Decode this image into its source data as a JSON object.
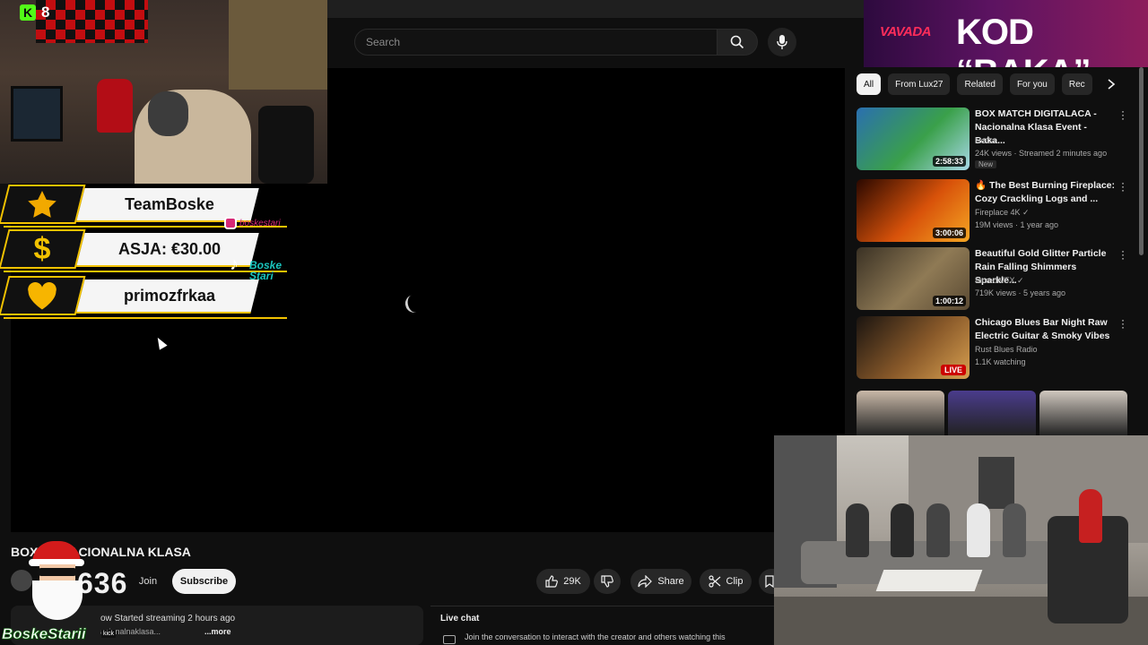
{
  "search": {
    "placeholder": "Search"
  },
  "video": {
    "title": "BOX MATCH DIGITALACA - NACIONALNA KLASA",
    "title_visible": "BOX        T - NACIONALNA KLASA",
    "subscriber_fragment": "636",
    "join_label": "Join",
    "subscribe_label": "Subscribe",
    "like_count": "29K",
    "share_label": "Share",
    "clip_label": "Clip",
    "description_line1": "ow  Started streaming 2 hours ago",
    "description_line2": "acionalnaklasa...",
    "description_more": "...more"
  },
  "live_chat": {
    "title": "Live chat",
    "message": "Join the conversation to interact with the creator and others watching this"
  },
  "sidebar": {
    "chips": [
      {
        "label": "All",
        "active": true
      },
      {
        "label": "From Lux27",
        "active": false
      },
      {
        "label": "Related",
        "active": false
      },
      {
        "label": "For you",
        "active": false
      },
      {
        "label": "Rec",
        "active": false
      }
    ],
    "recommendations": [
      {
        "title": "BOX MATCH DIGITALACA - Nacionalna Klasa Event - Baka...",
        "channel": "NeCa",
        "meta": "24K views · Streamed 2 minutes ago",
        "badge": "New",
        "duration": "2:58:33",
        "thumb_colors": [
          "#2a6fb0",
          "#3aa04a",
          "#a8d8e8"
        ]
      },
      {
        "title": "🔥 The Best Burning Fireplace: Cozy Crackling Logs and ...",
        "channel": "Fireplace 4K ✓",
        "meta": "19M views · 1 year ago",
        "badge": "",
        "duration": "3:00:06",
        "thumb_colors": [
          "#2a0800",
          "#d8520a",
          "#f5a623"
        ]
      },
      {
        "title": "Beautiful Gold Glitter Particle Rain Falling Shimmers Sparkle...",
        "channel": "IncrediVFX ✓",
        "meta": "719K views · 5 years ago",
        "badge": "",
        "duration": "1:00:12",
        "thumb_colors": [
          "#3a3124",
          "#8f7a55",
          "#5a4a33"
        ]
      },
      {
        "title": "Chicago Blues Bar Night Raw Electric Guitar & Smoky Vibes",
        "channel": "Rust Blues Radio",
        "meta": "1.1K watching",
        "badge": "",
        "live_label": "LIVE",
        "thumb_colors": [
          "#1a1410",
          "#8a5a2a",
          "#d8a050"
        ]
      }
    ],
    "short_colors": [
      "#c9b8a8",
      "#4a3c8c",
      "#d0c8bf"
    ]
  },
  "ad": {
    "brand": "VAVADA",
    "code_text": "KOD “BAKA”"
  },
  "stream_overlay": {
    "kick_viewers": "8",
    "donations": [
      {
        "icon": "star",
        "text": "TeamBoske"
      },
      {
        "icon": "dollar",
        "text": "ASJA: €30.00"
      },
      {
        "icon": "heart",
        "text": "primozfrkaa"
      }
    ],
    "instagram_handle": "boskestari",
    "tiktok_text": "Boske Stari",
    "brand_name": "BoskeStarii",
    "brand_tag": "kick"
  },
  "colors": {
    "accent_gold": "#f2c200",
    "youtube_bg": "#0f0f0f",
    "kick_green": "#53fc18",
    "live_red": "#cc0000"
  }
}
